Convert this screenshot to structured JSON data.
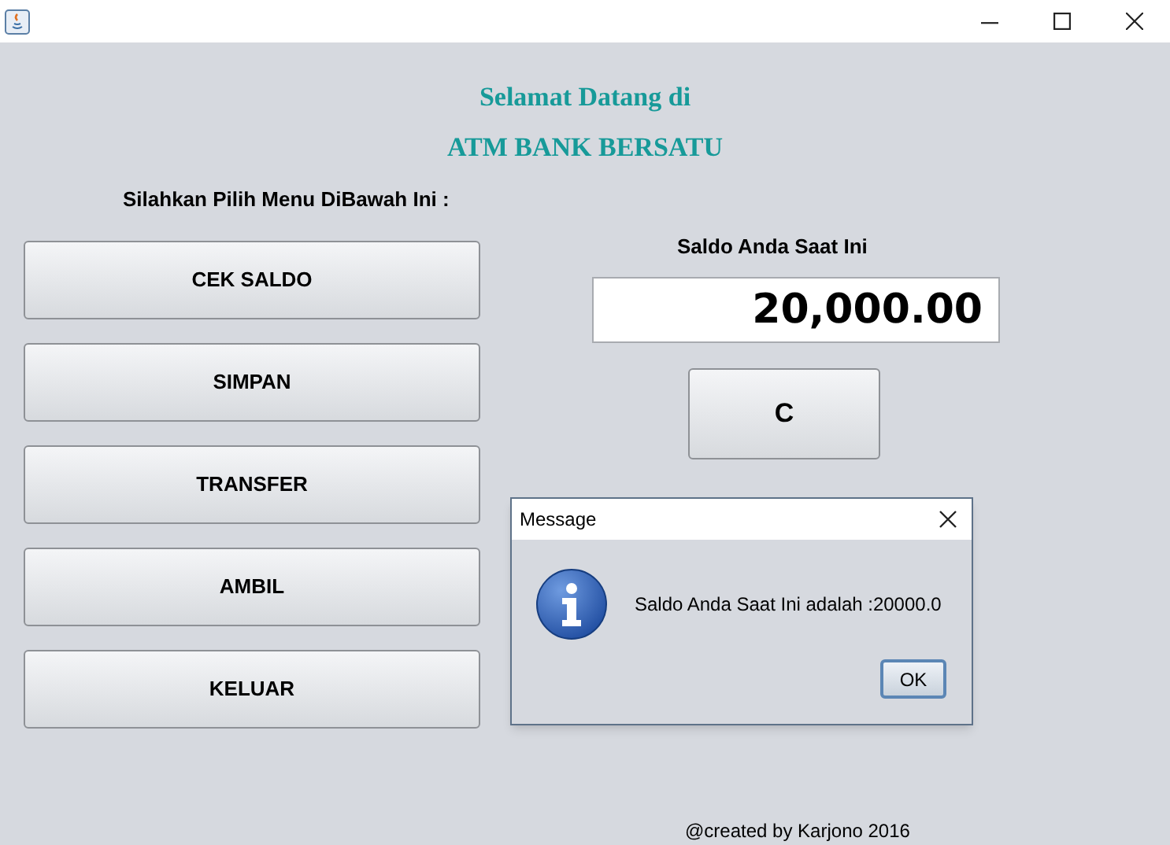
{
  "heading": [
    "Selamat Datang di",
    "ATM BANK BERSATU"
  ],
  "menu_prompt": "Silahkan Pilih Menu DiBawah Ini :",
  "menu_buttons": [
    "CEK SALDO",
    "SIMPAN",
    "TRANSFER",
    "AMBIL",
    "KELUAR"
  ],
  "balance": {
    "label": "Saldo Anda Saat Ini",
    "value": "20,000.00"
  },
  "clear_button": "C",
  "footer": "@created by Karjono 2016",
  "dialog": {
    "title": "Message",
    "message": "Saldo Anda Saat Ini adalah :20000.0",
    "button": "OK"
  }
}
